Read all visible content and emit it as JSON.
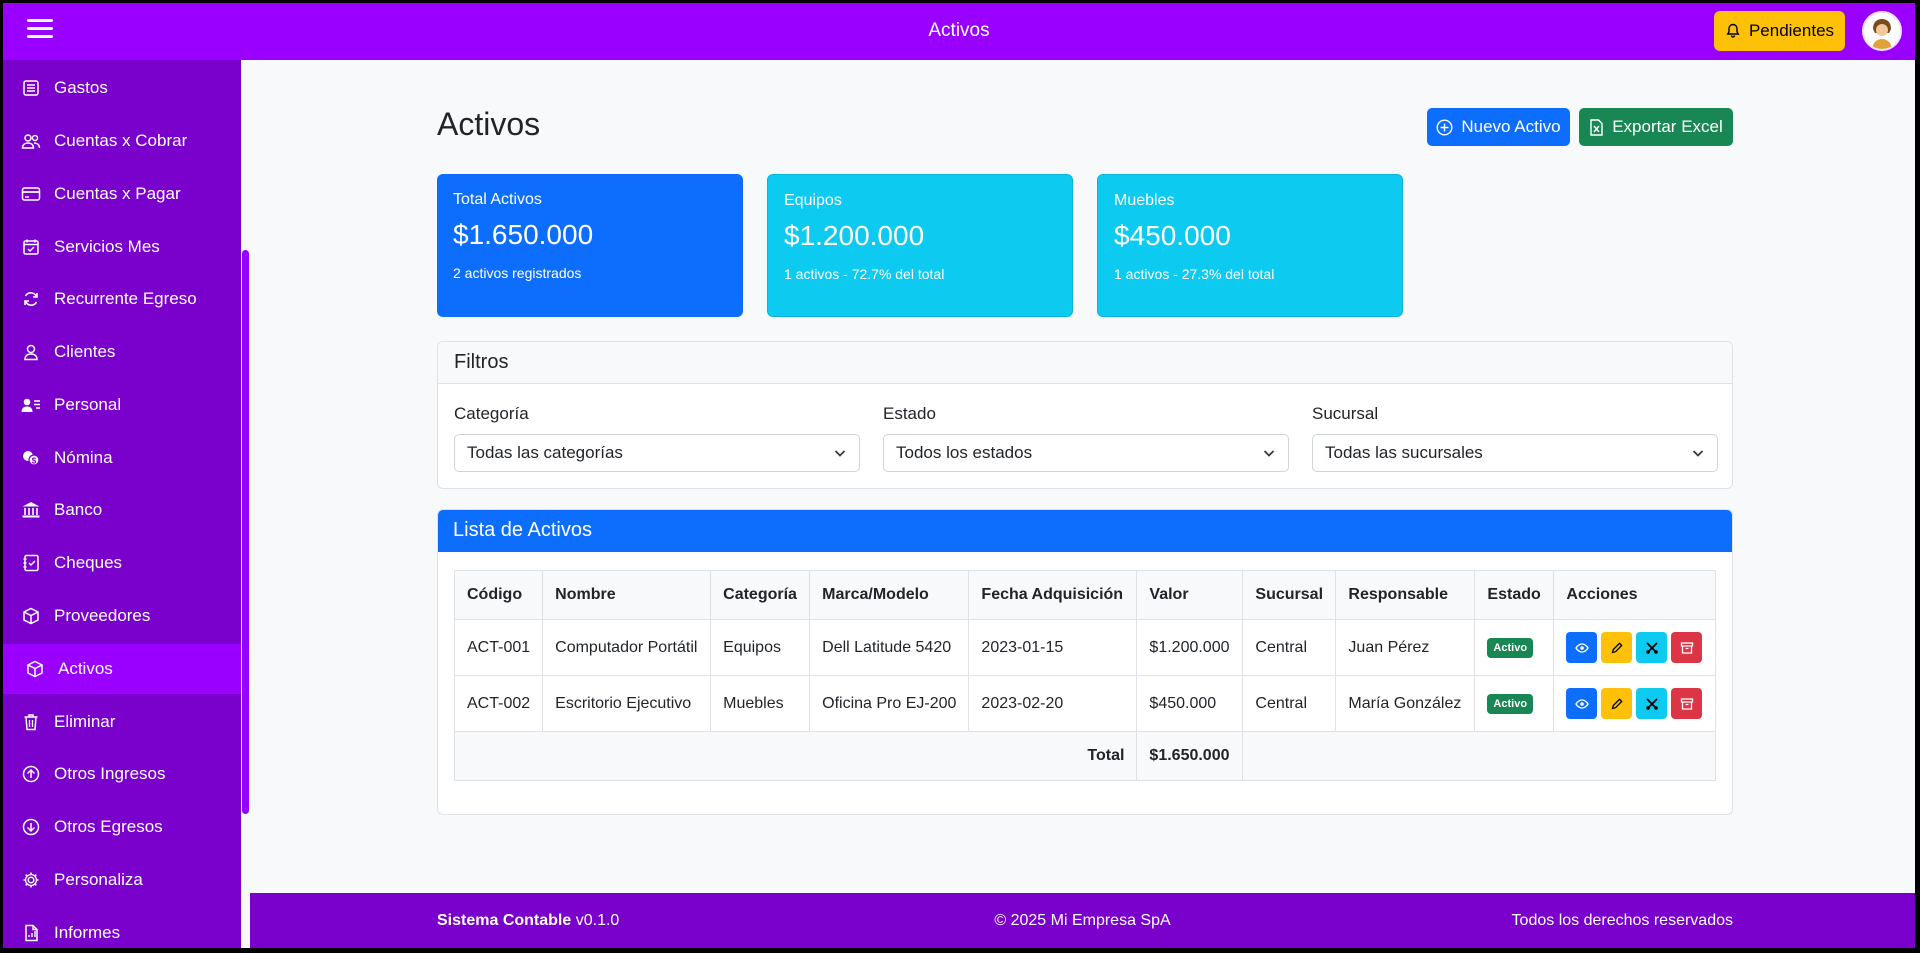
{
  "header": {
    "title": "Activos",
    "pending_label": "Pendientes"
  },
  "sidebar": {
    "items": [
      {
        "label": "Gastos",
        "icon": "list-icon"
      },
      {
        "label": "Cuentas x Cobrar",
        "icon": "people-icon"
      },
      {
        "label": "Cuentas x Pagar",
        "icon": "credit-card-icon"
      },
      {
        "label": "Servicios Mes",
        "icon": "calendar-check-icon"
      },
      {
        "label": "Recurrente Egreso",
        "icon": "refresh-icon"
      },
      {
        "label": "Clientes",
        "icon": "person-icon"
      },
      {
        "label": "Personal",
        "icon": "person-lines-icon"
      },
      {
        "label": "Nómina",
        "icon": "coins-icon"
      },
      {
        "label": "Banco",
        "icon": "bank-icon"
      },
      {
        "label": "Cheques",
        "icon": "journal-check-icon"
      },
      {
        "label": "Proveedores",
        "icon": "box-icon"
      },
      {
        "label": "Activos",
        "icon": "box-icon",
        "active": true
      },
      {
        "label": "Eliminar",
        "icon": "trash-icon"
      },
      {
        "label": "Otros Ingresos",
        "icon": "arrow-up-circle-icon"
      },
      {
        "label": "Otros Egresos",
        "icon": "arrow-down-circle-icon"
      },
      {
        "label": "Personaliza",
        "icon": "gear-icon"
      },
      {
        "label": "Informes",
        "icon": "file-icon"
      }
    ]
  },
  "main": {
    "title": "Activos",
    "new_label": "Nuevo Activo",
    "export_label": "Exportar Excel",
    "stats": {
      "total": {
        "label": "Total Activos",
        "value": "$1.650.000",
        "sub": "2 activos registrados"
      },
      "equipos": {
        "label": "Equipos",
        "value": "$1.200.000",
        "sub": "1 activos - 72.7% del total"
      },
      "muebles": {
        "label": "Muebles",
        "value": "$450.000",
        "sub": "1 activos - 27.3% del total"
      }
    },
    "filters": {
      "title": "Filtros",
      "categoria": {
        "label": "Categoría",
        "value": "Todas las categorías"
      },
      "estado": {
        "label": "Estado",
        "value": "Todos los estados"
      },
      "sucursal": {
        "label": "Sucursal",
        "value": "Todas las sucursales"
      }
    },
    "list": {
      "title": "Lista de Activos",
      "columns": [
        "Código",
        "Nombre",
        "Categoría",
        "Marca/Modelo",
        "Fecha Adquisición",
        "Valor",
        "Sucursal",
        "Responsable",
        "Estado",
        "Acciones"
      ],
      "rows": [
        [
          "ACT-001",
          "Computador Portátil",
          "Equipos",
          "Dell Latitude 5420",
          "2023-01-15",
          "$1.200.000",
          "Central",
          "Juan Pérez",
          "Activo"
        ],
        [
          "ACT-002",
          "Escritorio Ejecutivo",
          "Muebles",
          "Oficina Pro EJ-200",
          "2023-02-20",
          "$450.000",
          "Central",
          "María González",
          "Activo"
        ]
      ],
      "total_label": "Total",
      "total_value": "$1.650.000"
    }
  },
  "footer": {
    "brand": "Sistema Contable",
    "version": "v0.1.0",
    "copyright": "© 2025 Mi Empresa SpA",
    "rights": "Todos los derechos reservados"
  },
  "colors": {
    "header": "#9900ff",
    "sidebar": "#7a00cc",
    "primary": "#0d6efd",
    "info": "#0dcaf0",
    "success": "#198754",
    "warning": "#ffc107",
    "danger": "#dc3545"
  }
}
